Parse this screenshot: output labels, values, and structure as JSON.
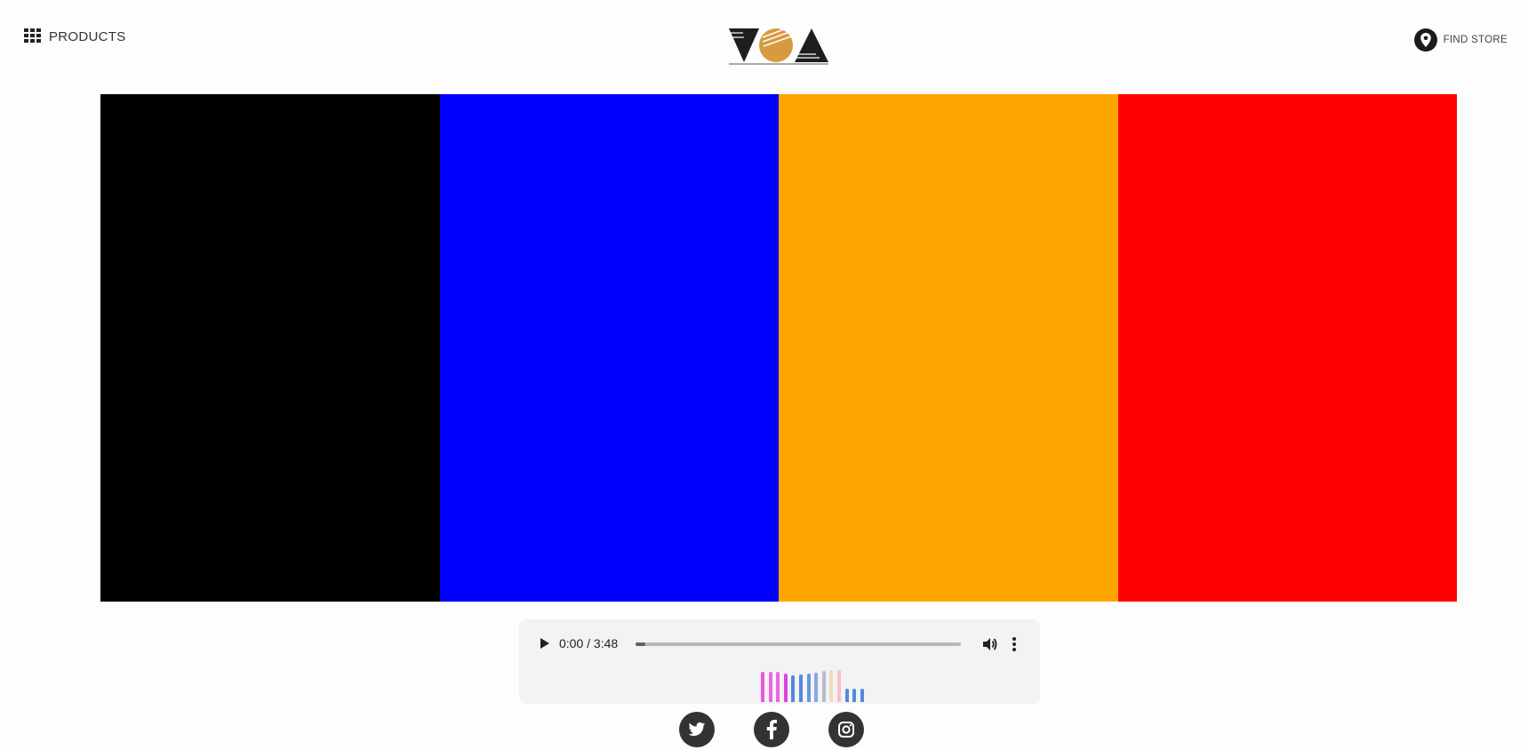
{
  "header": {
    "products_label": "PRODUCTS",
    "find_store_label": "FIND STORE",
    "logo_text": "VOA"
  },
  "color_bands": [
    {
      "name": "black",
      "color": "#000000"
    },
    {
      "name": "blue",
      "color": "#0000ff"
    },
    {
      "name": "orange",
      "color": "#ffa500"
    },
    {
      "name": "red",
      "color": "#ff0000"
    }
  ],
  "audio_player": {
    "time_display": "0:00 / 3:48",
    "progress_fraction": 0.03,
    "play_icon": "play-icon",
    "volume_icon": "volume-icon",
    "more_icon": "more-vertical-icon"
  },
  "equalizer": {
    "bars": [
      {
        "level": 0.95,
        "color": "#ee55dd"
      },
      {
        "level": 0.95,
        "color": "#ee66dd"
      },
      {
        "level": 0.95,
        "color": "#ee66dd"
      },
      {
        "level": 0.88,
        "color": "#dd44dd"
      },
      {
        "level": 0.82,
        "color": "#5588dd"
      },
      {
        "level": 0.85,
        "color": "#5588dd"
      },
      {
        "level": 0.88,
        "color": "#6699dd"
      },
      {
        "level": 0.92,
        "color": "#88aadd"
      },
      {
        "level": 0.98,
        "color": "#bbbbcc"
      },
      {
        "level": 1.0,
        "color": "#eeddbb"
      },
      {
        "level": 1.0,
        "color": "#ffbbcc"
      },
      {
        "level": 0.42,
        "color": "#5588dd"
      },
      {
        "level": 0.42,
        "color": "#5588dd"
      },
      {
        "level": 0.42,
        "color": "#5588dd"
      }
    ]
  },
  "social": [
    {
      "name": "twitter-icon"
    },
    {
      "name": "facebook-icon"
    },
    {
      "name": "instagram-icon"
    }
  ]
}
